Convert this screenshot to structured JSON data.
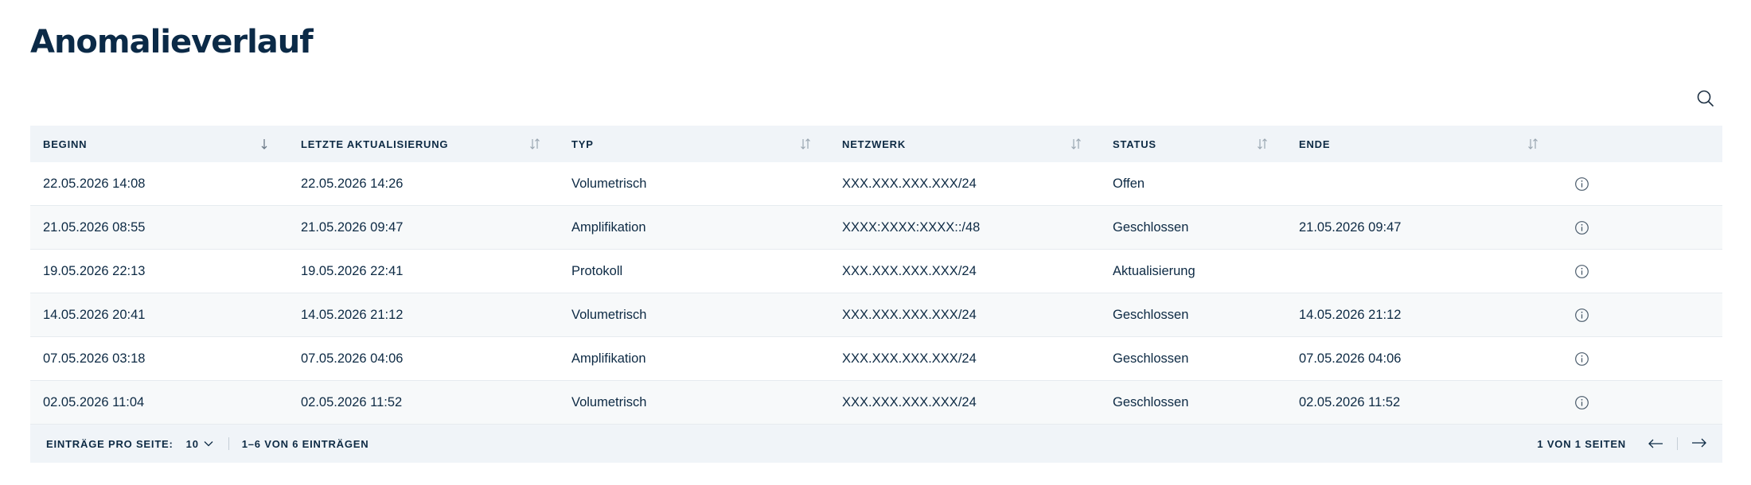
{
  "page": {
    "title": "Anomalieverlauf"
  },
  "table": {
    "columns": [
      {
        "label": "Beginn",
        "sort": "desc"
      },
      {
        "label": "Letzte Aktualisierung",
        "sort": "none"
      },
      {
        "label": "Typ",
        "sort": "none"
      },
      {
        "label": "Netzwerk",
        "sort": "none"
      },
      {
        "label": "Status",
        "sort": "none"
      },
      {
        "label": "Ende",
        "sort": "none"
      }
    ],
    "rows": [
      {
        "beginn": "22.05.2026 14:08",
        "aktualisiert": "22.05.2026 14:26",
        "typ": "Volumetrisch",
        "netzwerk": "XXX.XXX.XXX.XXX/24",
        "status": "Offen",
        "ende": ""
      },
      {
        "beginn": "21.05.2026 08:55",
        "aktualisiert": "21.05.2026 09:47",
        "typ": "Amplifikation",
        "netzwerk": "XXXX:XXXX:XXXX::/48",
        "status": "Geschlossen",
        "ende": "21.05.2026 09:47"
      },
      {
        "beginn": "19.05.2026 22:13",
        "aktualisiert": "19.05.2026 22:41",
        "typ": "Protokoll",
        "netzwerk": "XXX.XXX.XXX.XXX/24",
        "status": "Aktualisierung",
        "ende": ""
      },
      {
        "beginn": "14.05.2026 20:41",
        "aktualisiert": "14.05.2026 21:12",
        "typ": "Volumetrisch",
        "netzwerk": "XXX.XXX.XXX.XXX/24",
        "status": "Geschlossen",
        "ende": "14.05.2026 21:12"
      },
      {
        "beginn": "07.05.2026 03:18",
        "aktualisiert": "07.05.2026 04:06",
        "typ": "Amplifikation",
        "netzwerk": "XXX.XXX.XXX.XXX/24",
        "status": "Geschlossen",
        "ende": "07.05.2026 04:06"
      },
      {
        "beginn": "02.05.2026 11:04",
        "aktualisiert": "02.05.2026 11:52",
        "typ": "Volumetrisch",
        "netzwerk": "XXX.XXX.XXX.XXX/24",
        "status": "Geschlossen",
        "ende": "02.05.2026 11:52"
      }
    ]
  },
  "pagination": {
    "per_page_label": "Einträge pro Seite:",
    "per_page_value": "10",
    "range_text": "1–6 von 6 Einträgen",
    "pages_text": "1 von 1 Seiten"
  },
  "icons": {
    "search": "search-icon",
    "sort_desc": "arrow-down-icon",
    "sort_both": "sort-arrows-icon",
    "info": "info-icon",
    "chevron": "chevron-down-icon",
    "prev": "arrow-left-icon",
    "next": "arrow-right-icon"
  },
  "colors": {
    "text": "#0d2a44",
    "header_bg": "#f0f4f8",
    "alt_row_bg": "#f7f9fa",
    "icon": "#6b7a88"
  }
}
